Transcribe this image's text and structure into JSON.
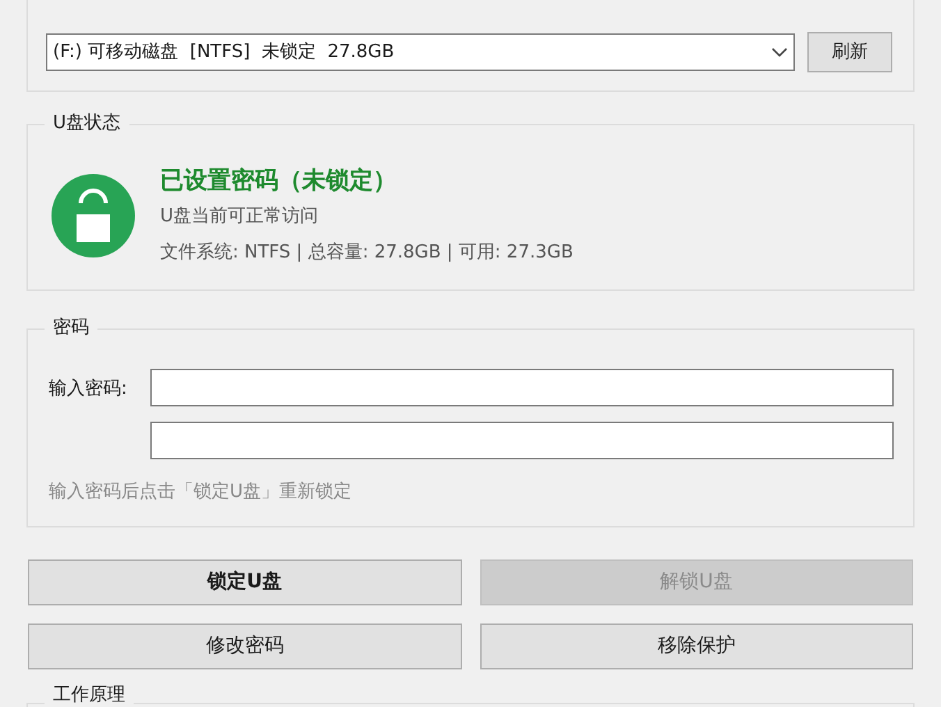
{
  "drive_select": {
    "value": "(F:) 可移动磁盘  [NTFS]  未锁定  27.8GB",
    "refresh_button": "刷新"
  },
  "status": {
    "title": "U盘状态",
    "locked": false,
    "headline": "已设置密码（未锁定）",
    "detail": "U盘当前可正常访问",
    "info": "文件系统: NTFS | 总容量: 27.8GB | 可用: 27.3GB"
  },
  "password": {
    "title": "密码",
    "label": "输入密码:",
    "hint": "输入密码后点击「锁定U盘」重新锁定"
  },
  "buttons": [
    {
      "label": "锁定U盘",
      "default": true,
      "disabled": false
    },
    {
      "label": "解锁U盘",
      "default": false,
      "disabled": true
    },
    {
      "label": "修改密码",
      "default": false,
      "disabled": false
    },
    {
      "label": "移除保护",
      "default": false,
      "disabled": false
    }
  ],
  "how_it_works": {
    "title": "工作原理"
  }
}
